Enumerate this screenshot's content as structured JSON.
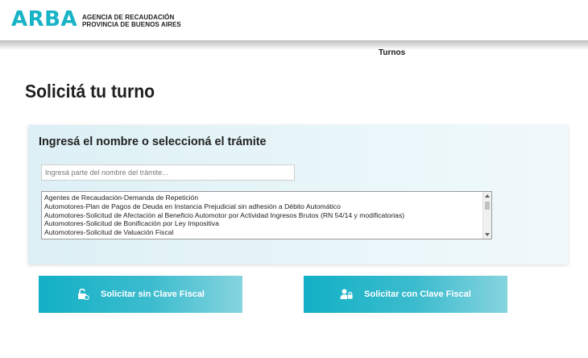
{
  "header": {
    "logo": "ARBA",
    "agency_line1": "AGENCIA DE RECAUDACIÓN",
    "agency_line2": "PROVINCIA DE BUENOS AIRES"
  },
  "nav": {
    "turnos": "Turnos"
  },
  "page": {
    "title": "Solicitá tu turno"
  },
  "panel": {
    "title": "Ingresá el nombre o seleccioná el trámite",
    "search": {
      "value": "",
      "placeholder": "Ingresá parte del nombre del trámite..."
    },
    "tramites": [
      "Agentes de Recaudación-Demanda de Repetición",
      "Automotores-Plan de Pagos de Deuda en Instancia Prejudicial sin adhesión a Débito Automático",
      "Automotores-Solicitud de Afectación al Beneficio Automotor por Actividad Ingresos Brutos (RN 54/14 y modificatorias)",
      "Automotores-Solicitud de Bonificación por Ley Impositiva",
      "Automotores-Solicitud de Valuación Fiscal"
    ]
  },
  "buttons": {
    "sin_clave": "Solicitar sin Clave Fiscal",
    "con_clave": "Solicitar con Clave Fiscal"
  },
  "colors": {
    "brand": "#17b3c6",
    "button_start": "#12b0c6",
    "button_end": "#86d4de"
  },
  "icons": {
    "sin_clave": "unlock-icon",
    "con_clave": "user-lock-icon"
  }
}
